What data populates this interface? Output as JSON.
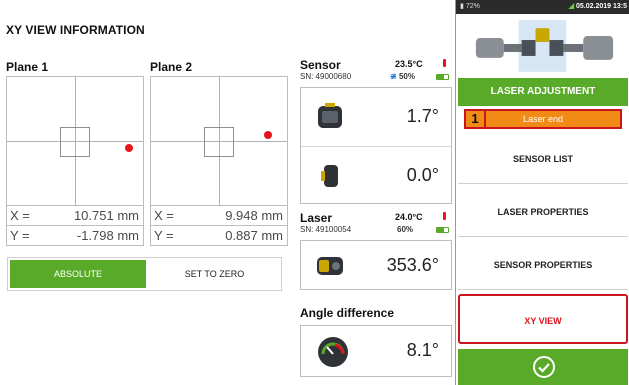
{
  "title": "XY VIEW INFORMATION",
  "planes": [
    {
      "label": "Plane 1",
      "x_key": "X =",
      "x_value": "10.751 mm",
      "y_key": "Y =",
      "y_value": "-1.798 mm"
    },
    {
      "label": "Plane 2",
      "x_key": "X =",
      "x_value": "9.948 mm",
      "y_key": "Y =",
      "y_value": "0.887 mm"
    }
  ],
  "toggle": {
    "absolute": "ABSOLUTE",
    "zero": "SET TO ZERO"
  },
  "sensor": {
    "title": "Sensor",
    "sn": "SN: 49000680",
    "temp": "23.5°C",
    "signal": "50%",
    "reading1": "1.7°",
    "reading2": "0.0°"
  },
  "laser": {
    "title": "Laser",
    "sn": "SN: 49100054",
    "temp": "24.0°C",
    "battery": "60%",
    "reading": "353.6°"
  },
  "angle": {
    "title": "Angle difference",
    "value": "8.1°"
  },
  "panel": {
    "status_battery": "72%",
    "status_date": "05.02.2019 13:5",
    "adjust_header": "LASER ADJUSTMENT",
    "laser_end": "Laser end",
    "callout": "1",
    "menu": [
      "SENSOR LIST",
      "LASER PROPERTIES",
      "SENSOR PROPERTIES",
      "XY VIEW"
    ]
  },
  "colors": {
    "accent": "#5aaa2a",
    "highlight": "#f28b16",
    "alert": "#d9141c"
  }
}
